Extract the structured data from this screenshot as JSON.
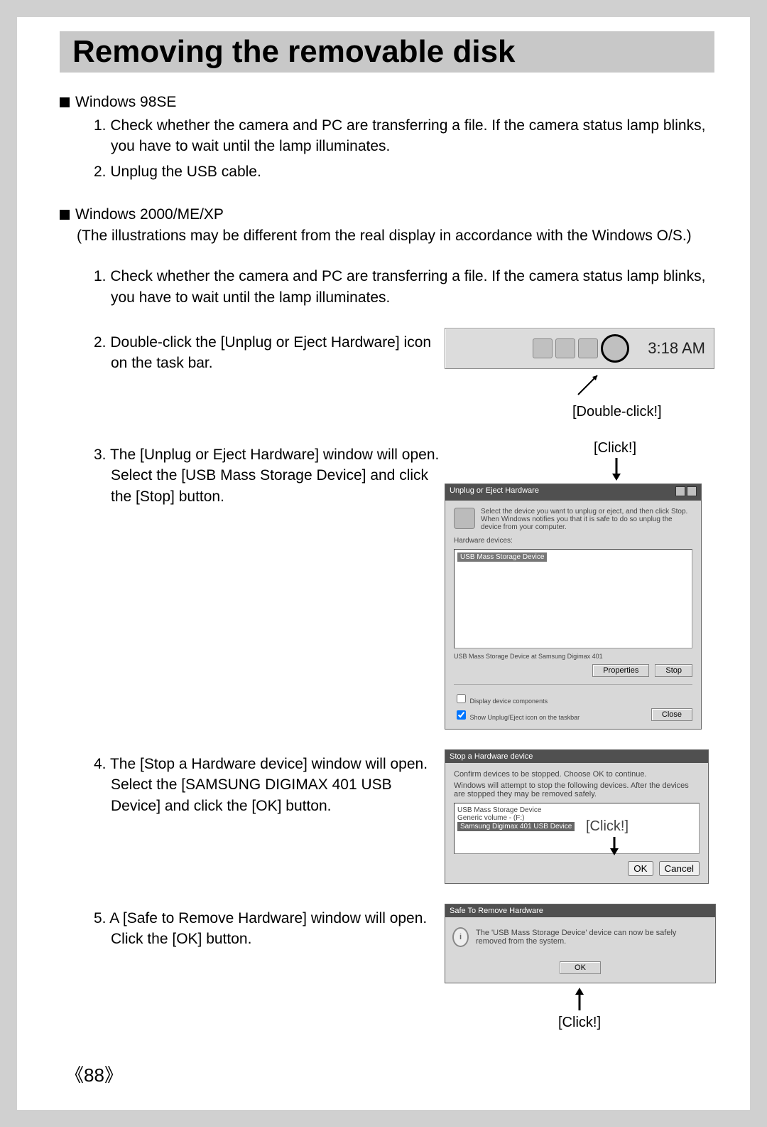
{
  "title": "Removing the removable disk",
  "section98": {
    "heading": "Windows 98SE",
    "step1": "1. Check whether the camera and PC are transferring a file. If the camera status lamp blinks, you have to wait until the lamp illuminates.",
    "step2": "2. Unplug the USB cable."
  },
  "section2000": {
    "heading": "Windows 2000/ME/XP",
    "note": "(The illustrations may be different from the real display in accordance with the Windows O/S.)",
    "step1": "1. Check whether the camera and PC are transferring a file. If the camera status lamp blinks, you have to wait until the lamp illuminates.",
    "step2": "2. Double-click the [Unplug or Eject Hardware] icon on the task bar.",
    "step3": "3. The [Unplug or Eject Hardware] window will open. Select the [USB Mass Storage Device] and click the [Stop] button.",
    "step4": "4. The [Stop a Hardware device] window will open. Select the [SAMSUNG DIGIMAX 401 USB Device] and click the [OK] button.",
    "step5": "5. A [Safe to Remove Hardware] window will open. Click the [OK] button."
  },
  "captions": {
    "doubleclick": "[Double-click!]",
    "click": "[Click!]"
  },
  "taskbar": {
    "time": "3:18 AM"
  },
  "dialog1": {
    "title": "Unplug or Eject Hardware",
    "desc": "Select the device you want to unplug or eject, and then click Stop. When Windows notifies you that it is safe to do so unplug the device from your computer.",
    "listlabel": "Hardware devices:",
    "selected": "USB Mass Storage Device",
    "footer": "USB Mass Storage Device at Samsung Digimax 401",
    "btn_props": "Properties",
    "btn_stop": "Stop",
    "chk1": "Display device components",
    "chk2": "Show Unplug/Eject icon on the taskbar",
    "btn_close": "Close"
  },
  "dialog2": {
    "title": "Stop a Hardware device",
    "desc": "Confirm devices to be stopped. Choose OK to continue.",
    "desc2": "Windows will attempt to stop the following devices. After the devices are stopped they may be removed safely.",
    "line1": "USB Mass Storage Device",
    "line2": "Generic volume - (F:)",
    "selected": "Samsung Digimax 401 USB Device",
    "btn_ok": "OK",
    "btn_cancel": "Cancel"
  },
  "dialog3": {
    "title": "Safe To Remove Hardware",
    "msg": "The 'USB Mass Storage Device' device can now be safely removed from the system.",
    "btn_ok": "OK"
  },
  "page_number": "88"
}
